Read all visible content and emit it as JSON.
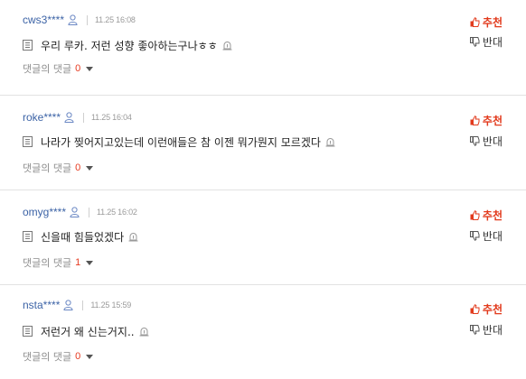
{
  "comments": [
    {
      "author": "cws3****",
      "time": "11.25 16:08",
      "text": "우리 루카. 저런 성향 좋아하는구나ㅎㅎ",
      "reply_label": "댓글의 댓글",
      "reply_count": "0",
      "up_label": "추천",
      "down_label": "반대"
    },
    {
      "author": "roke****",
      "time": "11.25 16:04",
      "text": "나라가 찢어지고있는데 이런애들은 참 이젠 뭐가뭔지 모르겠다",
      "reply_label": "댓글의 댓글",
      "reply_count": "0",
      "up_label": "추천",
      "down_label": "반대"
    },
    {
      "author": "omyg****",
      "time": "11.25 16:02",
      "text": "신을때 힘들었겠다",
      "reply_label": "댓글의 댓글",
      "reply_count": "1",
      "up_label": "추천",
      "down_label": "반대"
    },
    {
      "author": "nsta****",
      "time": "11.25 15:59",
      "text": "저런거 왜 신는거지..",
      "reply_label": "댓글의 댓글",
      "reply_count": "0",
      "up_label": "추천",
      "down_label": "반대"
    }
  ],
  "icons": {
    "user": "user-icon",
    "comment": "document-icon",
    "report": "report-siren-icon",
    "up": "thumbs-up-icon",
    "down": "thumbs-down-icon",
    "toggle": "caret-down-icon"
  },
  "colors": {
    "author": "#3c63a6",
    "up": "#e23a1c",
    "reply_count": "#e63a20",
    "divider": "#e2e2e2"
  }
}
